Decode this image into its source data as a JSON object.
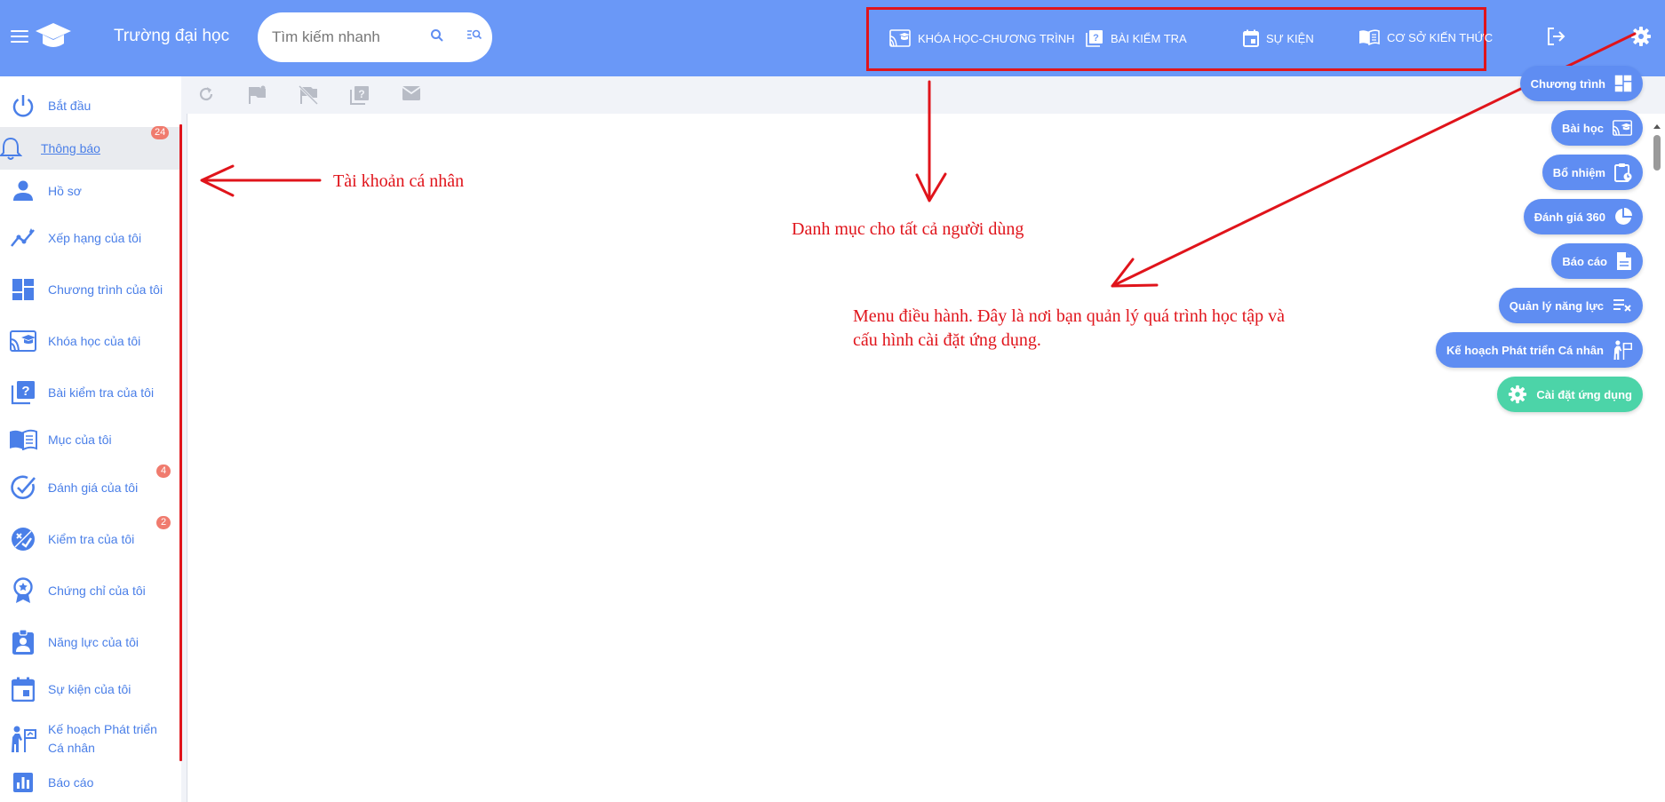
{
  "header": {
    "app_title": "Trường đại học",
    "search_placeholder": "Tìm kiếm nhanh",
    "nav": [
      {
        "label": "KHÓA HỌC-CHƯƠNG TRÌNH",
        "icon": "cast-education-icon"
      },
      {
        "label": "BÀI KIỂM TRA",
        "icon": "quiz-icon"
      },
      {
        "label": "SỰ KIỆN",
        "icon": "calendar-icon"
      },
      {
        "label": "CƠ SỞ KIẾN THỨC",
        "icon": "book-icon"
      }
    ]
  },
  "sidebar": {
    "items": [
      {
        "label": "Bắt đầu",
        "icon": "power-icon"
      },
      {
        "label": "Thông báo",
        "icon": "bell-icon",
        "badge": "24",
        "active": true
      },
      {
        "label": "Hồ sơ",
        "icon": "person-icon"
      },
      {
        "label": "Xếp hạng của tôi",
        "icon": "ranking-icon"
      },
      {
        "label": "Chương trình của tôi",
        "icon": "dashboard-icon"
      },
      {
        "label": "Khóa học của tôi",
        "icon": "cast-education-icon"
      },
      {
        "label": "Bài kiểm tra của tôi",
        "icon": "quiz-icon"
      },
      {
        "label": "Mục của tôi",
        "icon": "book-icon"
      },
      {
        "label": "Đánh giá của tôi",
        "icon": "check-circle-icon",
        "badge": "4"
      },
      {
        "label": "Kiểm tra của tôi",
        "icon": "exam-icon",
        "badge": "2"
      },
      {
        "label": "Chứng chỉ của tôi",
        "icon": "certificate-icon"
      },
      {
        "label": "Năng lực của tôi",
        "icon": "badge-person-icon"
      },
      {
        "label": "Sự kiện của tôi",
        "icon": "calendar-icon"
      },
      {
        "label": "Kế hoạch Phát triển Cá nhân",
        "icon": "development-icon"
      },
      {
        "label": "Báo cáo",
        "icon": "chart-icon"
      }
    ]
  },
  "toolbar": {
    "icons": [
      "refresh-icon",
      "flag-icon",
      "flag-off-icon",
      "quiz-icon",
      "mail-icon"
    ]
  },
  "annotations": {
    "personal_account": "Tài khoản cá nhân",
    "categories_all_users": "Danh mục cho tất cả người dùng",
    "admin_menu_line1": "Menu điều hành. Đây là nơi bạn quản lý quá trình học tập và",
    "admin_menu_line2": "cấu hình cài đặt ứng dụng."
  },
  "admin_menu": {
    "items": [
      {
        "label": "Chương trình",
        "icon": "dashboard-icon"
      },
      {
        "label": "Bài học",
        "icon": "cast-education-icon"
      },
      {
        "label": "Bổ nhiệm",
        "icon": "clipboard-clock-icon"
      },
      {
        "label": "Đánh giá 360",
        "icon": "pie-chart-icon"
      },
      {
        "label": "Báo cáo",
        "icon": "document-icon"
      },
      {
        "label": "Quản lý năng lực",
        "icon": "list-remove-icon"
      },
      {
        "label": "Kế hoạch Phát triển Cá nhân",
        "icon": "development-icon"
      },
      {
        "label": "Cài đặt ứng dụng",
        "icon": "gear-icon"
      }
    ]
  },
  "colors": {
    "header_bg": "#6a98f7",
    "accent": "#4a7fe8",
    "annotation_red": "#e0141b",
    "badge": "#f07b6e",
    "admin_green": "#4cd4a8"
  }
}
